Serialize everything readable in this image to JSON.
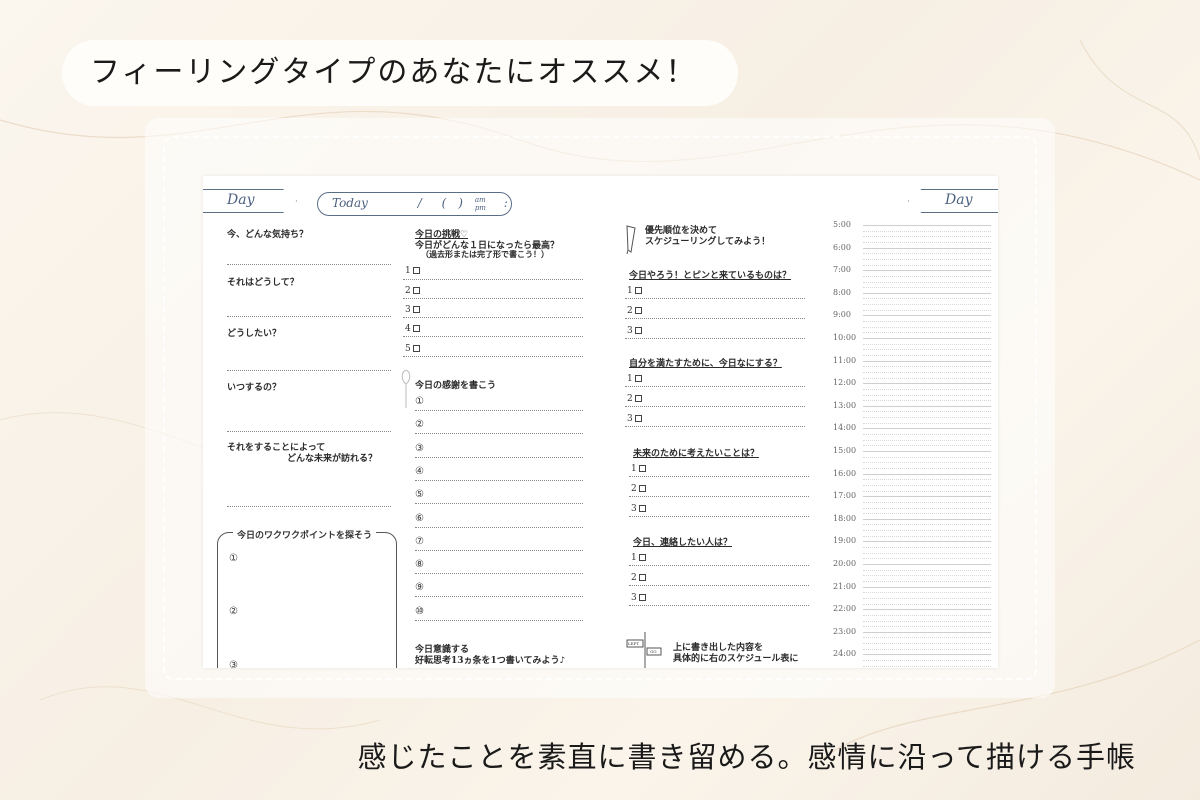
{
  "headline": "フィーリングタイプのあなたにオススメ！",
  "caption": "感じたことを素直に書き留める。感情に沿って描ける手帳",
  "tabs": {
    "day_left": "Day",
    "day_right": "Day",
    "today": "Today",
    "slash": "/",
    "paren": "(　)",
    "am": "am",
    "pm": "pm",
    "colon": ":"
  },
  "col1": {
    "q1": "今、どんな気持ち？",
    "q2": "それはどうして？",
    "q3": "どうしたい？",
    "q4": "いつするの？",
    "q5a": "それをすることによって",
    "q5b": "どんな未来が訪れる？",
    "bubble_title": "今日のワクワクポイントを探そう",
    "b1": "①",
    "b2": "②",
    "b3": "③"
  },
  "col2": {
    "challenge_title": "今日の挑戦♡",
    "challenge_q": "今日がどんな１日になったら最高？",
    "challenge_note": "（過去形または完了形で書こう！）",
    "n1": "1",
    "n2": "2",
    "n3": "3",
    "n4": "4",
    "n5": "5",
    "thanks_title": "今日の感謝を書こう",
    "c": [
      "①",
      "②",
      "③",
      "④",
      "⑤",
      "⑥",
      "⑦",
      "⑧",
      "⑨",
      "⑩"
    ],
    "footer1": "今日意識する",
    "footer2": "好転思考13ヵ条を1つ書いてみよう♪"
  },
  "col3": {
    "intro1": "優先順位を決めて",
    "intro2": "スケジューリングしてみよう！",
    "s1": "今日やろう！とピンと来ているものは？",
    "s2": "自分を満たすために、今日なにする？",
    "s3": "未来のために考えたいことは？",
    "s4": "今日、連絡したい人は？",
    "n1": "1",
    "n2": "2",
    "n3": "3",
    "sign1": "LEFT",
    "sign2": "GO",
    "footer1": "上に書き出した内容を",
    "footer2": "具体的に右のスケジュール表に"
  },
  "times": [
    "5:00",
    "6:00",
    "7:00",
    "8:00",
    "9:00",
    "10:00",
    "11:00",
    "12:00",
    "13:00",
    "14:00",
    "15:00",
    "16:00",
    "17:00",
    "18:00",
    "19:00",
    "20:00",
    "21:00",
    "22:00",
    "23:00",
    "24:00"
  ],
  "colors": {
    "accent": "#4c6180",
    "bg": "#f9f2e8"
  }
}
